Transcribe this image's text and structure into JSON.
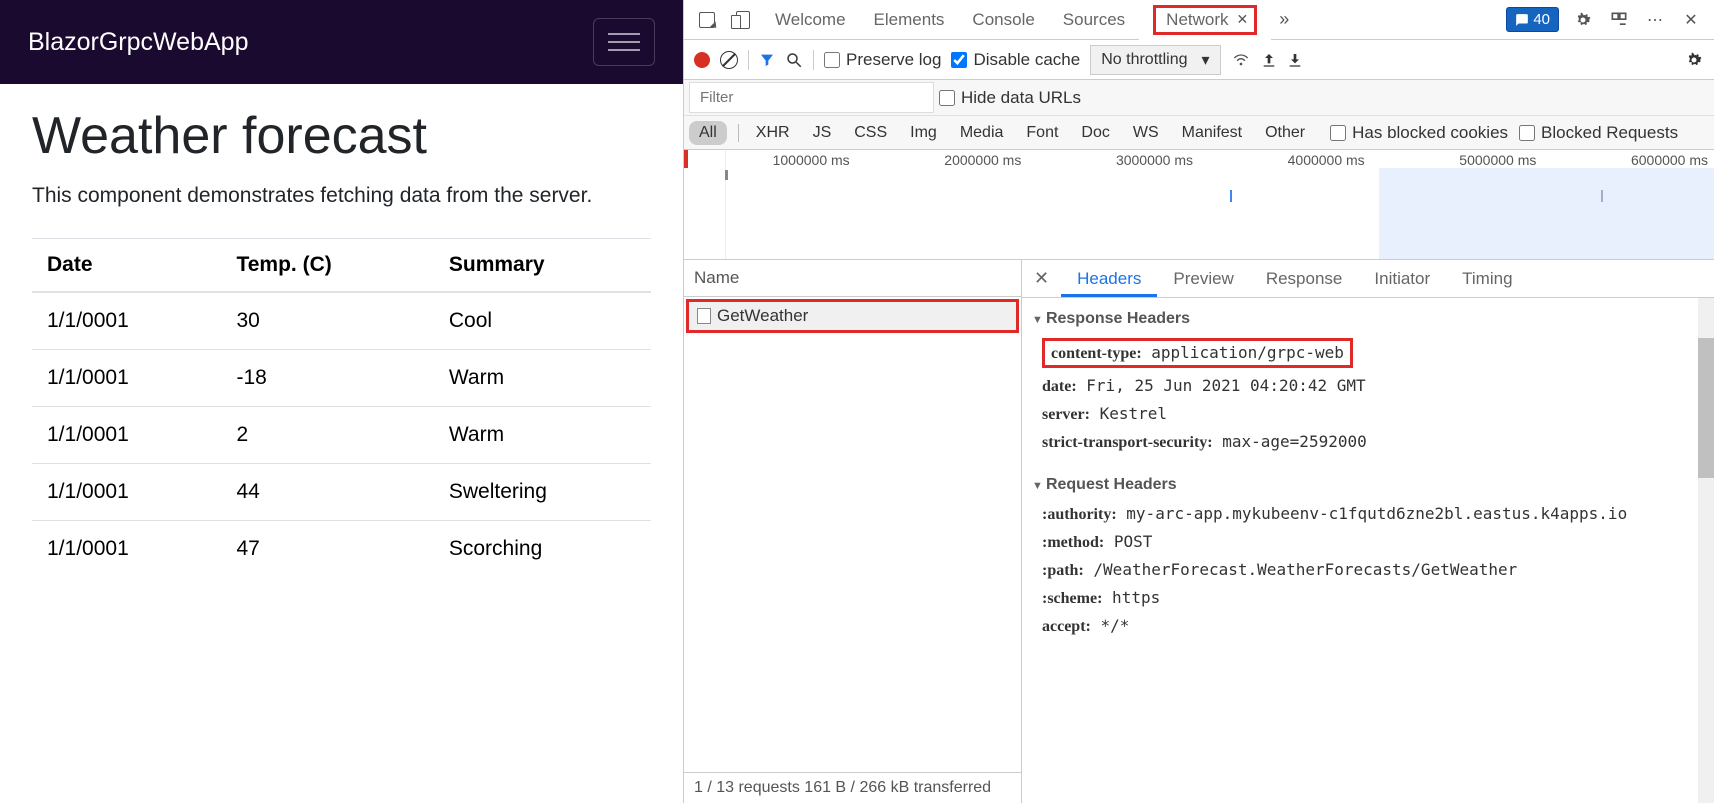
{
  "app": {
    "brand": "BlazorGrpcWebApp",
    "title": "Weather forecast",
    "description": "This component demonstrates fetching data from the server.",
    "table": {
      "headers": [
        "Date",
        "Temp. (C)",
        "Summary"
      ],
      "rows": [
        {
          "date": "1/1/0001",
          "temp": "30",
          "summary": "Cool"
        },
        {
          "date": "1/1/0001",
          "temp": "-18",
          "summary": "Warm"
        },
        {
          "date": "1/1/0001",
          "temp": "2",
          "summary": "Warm"
        },
        {
          "date": "1/1/0001",
          "temp": "44",
          "summary": "Sweltering"
        },
        {
          "date": "1/1/0001",
          "temp": "47",
          "summary": "Scorching"
        }
      ]
    }
  },
  "devtools": {
    "topTabs": [
      "Welcome",
      "Elements",
      "Console",
      "Sources",
      "Network"
    ],
    "activeTopTab": "Network",
    "issuesCount": "40",
    "toolbar": {
      "preserveLog": "Preserve log",
      "disableCache": "Disable cache",
      "throttling": "No throttling"
    },
    "filterPlaceholder": "Filter",
    "hideDataUrls": "Hide data URLs",
    "types": [
      "All",
      "XHR",
      "JS",
      "CSS",
      "Img",
      "Media",
      "Font",
      "Doc",
      "WS",
      "Manifest",
      "Other"
    ],
    "hasBlockedCookies": "Has blocked cookies",
    "blockedRequests": "Blocked Requests",
    "timeline": {
      "labels": [
        "1000000 ms",
        "2000000 ms",
        "3000000 ms",
        "4000000 ms",
        "5000000 ms",
        "6000000 ms"
      ]
    },
    "requestList": {
      "header": "Name",
      "items": [
        "GetWeather"
      ]
    },
    "details": {
      "tabs": [
        "Headers",
        "Preview",
        "Response",
        "Initiator",
        "Timing"
      ],
      "activeTab": "Headers",
      "responseHeadersLabel": "Response Headers",
      "responseHeaders": [
        {
          "k": "content-type:",
          "v": "application/grpc-web",
          "highlight": true
        },
        {
          "k": "date:",
          "v": "Fri, 25 Jun 2021 04:20:42 GMT"
        },
        {
          "k": "server:",
          "v": "Kestrel"
        },
        {
          "k": "strict-transport-security:",
          "v": "max-age=2592000"
        }
      ],
      "requestHeadersLabel": "Request Headers",
      "requestHeaders": [
        {
          "k": ":authority:",
          "v": "my-arc-app.mykubeenv-c1fqutd6zne2bl.eastus.k4apps.io"
        },
        {
          "k": ":method:",
          "v": "POST"
        },
        {
          "k": ":path:",
          "v": "/WeatherForecast.WeatherForecasts/GetWeather"
        },
        {
          "k": ":scheme:",
          "v": "https"
        },
        {
          "k": "accept:",
          "v": "*/*"
        }
      ]
    },
    "status": "1 / 13 requests  161 B / 266 kB transferred"
  }
}
